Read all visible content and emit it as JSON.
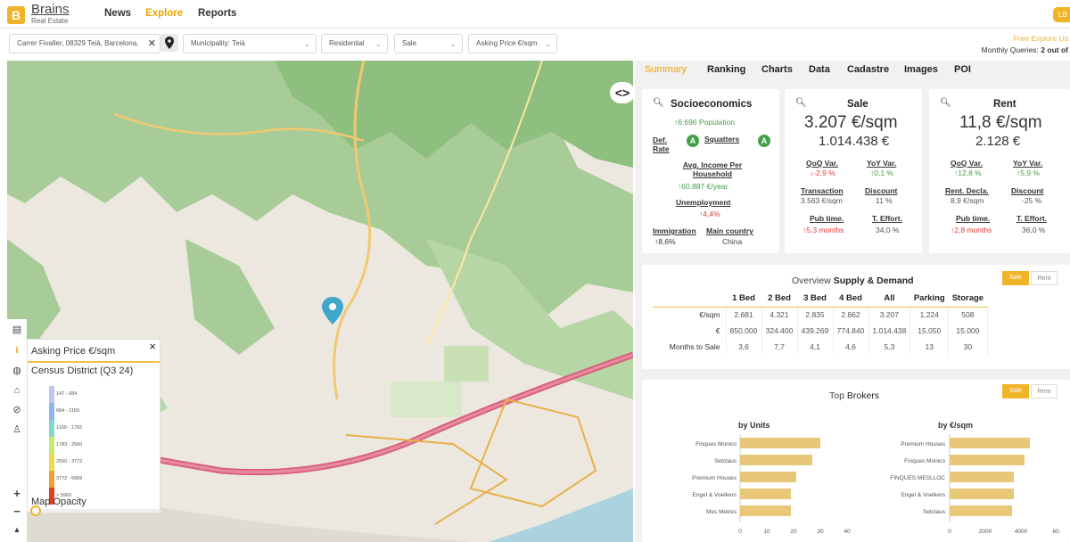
{
  "brand": {
    "name": "Brains",
    "subtitle": "Real Estate",
    "initial": "B"
  },
  "nav": [
    {
      "label": "News",
      "active": false
    },
    {
      "label": "Explore",
      "active": true
    },
    {
      "label": "Reports",
      "active": false
    }
  ],
  "user": {
    "initials": "LB"
  },
  "filters": {
    "address": "Carrer Fivaller, 08329 Teià, Barcelona,",
    "municipality": "Municipality: Teià",
    "type": "Residential",
    "operation": "Sale",
    "metric": "Asking Price €/sqm"
  },
  "promo": {
    "line1": "Free Explore Us",
    "line2_prefix": "Monthly Queries: ",
    "line2_value": "2 out of"
  },
  "map": {
    "legend_title": "Asking Price €/sqm",
    "legend_subtitle": "Census District (Q3 24)",
    "legend_colors": [
      "#c0c4f0",
      "#8fb4f0",
      "#7fd8c8",
      "#c8e870",
      "#f0d850",
      "#f0a030",
      "#e04020"
    ],
    "legend_ranges": [
      "147 - 684",
      "684 - 1169",
      "1169 - 1783",
      "1783 - 2560",
      "2560 - 3772",
      "3772 - 5969",
      "> 5969"
    ],
    "opacity_label": "Map Opacity",
    "collapse_label": "<>",
    "tools": [
      "save-icon",
      "info-icon",
      "globe-icon",
      "unlock-icon",
      "eye-off-icon",
      "person-icon"
    ],
    "zoom_in": "+",
    "zoom_out": "−"
  },
  "tabs": [
    "Summary",
    "Ranking",
    "Charts",
    "Data",
    "Cadastre",
    "Images",
    "POI"
  ],
  "socio": {
    "title": "Socioeconomics",
    "population": "6.696 Population",
    "def_rate": "Def. Rate",
    "def_grade": "A",
    "squatters": "Squatters",
    "squatters_grade": "A",
    "income_label": "Avg. Income Per Household",
    "income_value": "60.887 €/year",
    "unemp_label": "Unemployment",
    "unemp_value": "4,4%",
    "immig_label": "Immigration",
    "immig_value": "8,6%",
    "country_label": "Main country",
    "country_value": "China"
  },
  "sale": {
    "title": "Sale",
    "sqm": "3.207 €/sqm",
    "total": "1.014.438 €",
    "qoq_label": "QoQ Var.",
    "qoq_value": "-2,9 %",
    "yoy_label": "YoY Var.",
    "yoy_value": "0,1 %",
    "tr_label": "Transaction",
    "tr_value": "3.563 €/sqm",
    "disc_label": "Discount",
    "disc_value": "11 %",
    "pub_label": "Pub time.",
    "pub_value": "5,3 months",
    "eff_label": "T. Effort.",
    "eff_value": "34,0 %"
  },
  "rent": {
    "title": "Rent",
    "sqm": "11,8 €/sqm",
    "total": "2.128 €",
    "qoq_label": "QoQ Var.",
    "qoq_value": "12,8 %",
    "yoy_label": "YoY Var.",
    "yoy_value": "5,9 %",
    "decl_label": "Rent. Decla.",
    "decl_value": "8,9 €/sqm",
    "disc_label": "Discount",
    "disc_value": "-25 %",
    "pub_label": "Pub time.",
    "pub_value": "2,8 months",
    "eff_label": "T. Effort.",
    "eff_value": "36,0 %"
  },
  "supply": {
    "title_prefix": "Overview ",
    "title_bold": "Supply & Demand",
    "toggle_on": "Sale",
    "toggle_off": "Rent",
    "columns": [
      "",
      "1 Bed",
      "2 Bed",
      "3 Bed",
      "4 Bed",
      "All",
      "Parking",
      "Storage"
    ],
    "rows": [
      [
        "€/sqm",
        "2.681",
        "4.321",
        "2.835",
        "2.862",
        "3.207",
        "1.224",
        "508"
      ],
      [
        "€",
        "850.000",
        "324.400",
        "439.269",
        "774.840",
        "1.014.438",
        "15.050",
        "15.000"
      ],
      [
        "Months to Sale",
        "3,6",
        "7,7",
        "4,1",
        "4,6",
        "5,3",
        "13",
        "30"
      ]
    ]
  },
  "brokers": {
    "title_prefix": "Top ",
    "title_bold": "Brokers",
    "toggle_on": "Sale",
    "toggle_off": "Rent",
    "units_title": "by Units",
    "sqm_title": "by €/sqm",
    "bar_color": "#e8c878"
  },
  "chart_data": [
    {
      "type": "bar",
      "title": "by Units",
      "orientation": "horizontal",
      "categories": [
        "Finques Monico",
        "Setclaus",
        "Premium Houses",
        "Engel & Voelkers",
        "Mes Metres"
      ],
      "values": [
        30,
        27,
        21,
        19,
        19
      ],
      "xlim": [
        0,
        40
      ],
      "ticks": [
        "0",
        "10",
        "20",
        "30",
        "40"
      ]
    },
    {
      "type": "bar",
      "title": "by €/sqm",
      "orientation": "horizontal",
      "categories": [
        "Premium Houses",
        "Finques Monico",
        "FINQUES MESLLOC",
        "Engel & Voelkers",
        "Setclaus"
      ],
      "values": [
        4500,
        4200,
        3600,
        3600,
        3500
      ],
      "xlim": [
        0,
        6000
      ],
      "ticks": [
        "0",
        "2000",
        "4000",
        "60."
      ]
    }
  ]
}
